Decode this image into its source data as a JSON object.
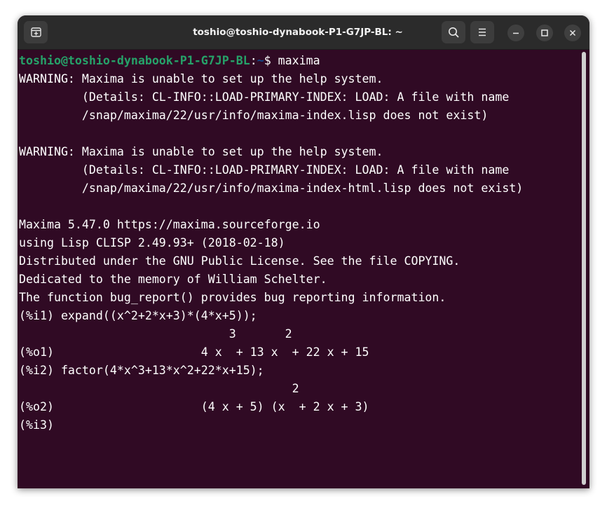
{
  "window": {
    "title": "toshio@toshio-dynabook-P1-G7JP-BL: ~",
    "icons": {
      "new_tab": "new-tab-icon",
      "search": "search-icon",
      "menu": "hamburger-menu-icon",
      "minimize": "minimize-icon",
      "maximize": "maximize-icon",
      "close": "close-icon"
    }
  },
  "colors": {
    "terminal_bg": "#300a24",
    "prompt_user": "#26a269",
    "prompt_path": "#12488b",
    "text": "#ffffff",
    "titlebar": "#2b2b2b"
  },
  "terminal": {
    "prompt_user_host": "toshio@toshio-dynabook-P1-G7JP-BL",
    "prompt_colon": ":",
    "prompt_path": "~",
    "prompt_symbol": "$ ",
    "prompt_command": "maxima",
    "lines": [
      "WARNING: Maxima is unable to set up the help system.",
      "         (Details: CL-INFO::LOAD-PRIMARY-INDEX: LOAD: A file with name",
      "         /snap/maxima/22/usr/info/maxima-index.lisp does not exist)",
      "",
      "WARNING: Maxima is unable to set up the help system.",
      "         (Details: CL-INFO::LOAD-PRIMARY-INDEX: LOAD: A file with name",
      "         /snap/maxima/22/usr/info/maxima-index-html.lisp does not exist)",
      "",
      "Maxima 5.47.0 https://maxima.sourceforge.io",
      "using Lisp CLISP 2.49.93+ (2018-02-18)",
      "Distributed under the GNU Public License. See the file COPYING.",
      "Dedicated to the memory of William Schelter.",
      "The function bug_report() provides bug reporting information.",
      "(%i1) expand((x^2+2*x+3)*(4*x+5));",
      "                              3       2",
      "(%o1)                     4 x  + 13 x  + 22 x + 15",
      "(%i2) factor(4*x^3+13*x^2+22*x+15);",
      "                                       2",
      "(%o2)                     (4 x + 5) (x  + 2 x + 3)",
      "(%i3) "
    ]
  }
}
